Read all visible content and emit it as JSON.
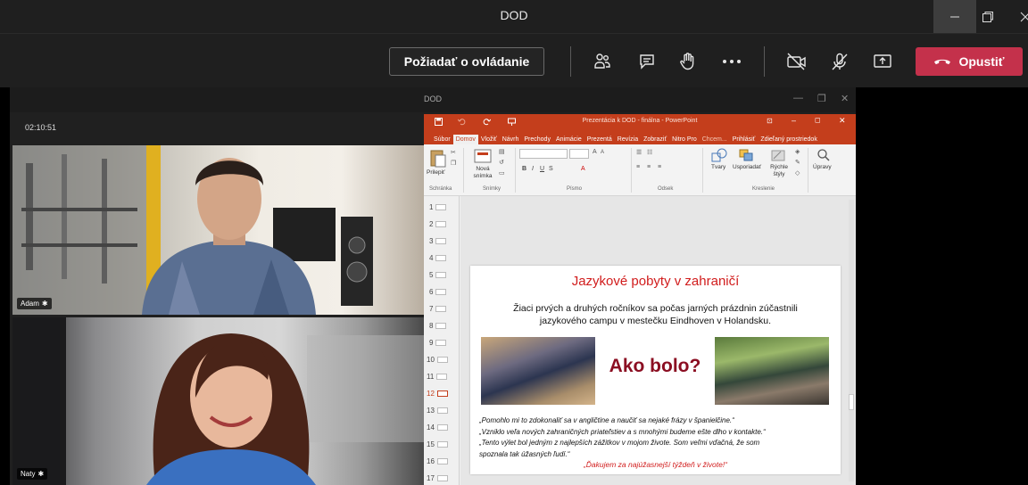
{
  "window": {
    "title": "DOD"
  },
  "toolbar": {
    "request_control_label": "Požiadať o ovládanie",
    "leave_label": "Opustiť",
    "colors": {
      "leave": "#c4314b"
    }
  },
  "share": {
    "window_title": "DOD",
    "elapsed": "02:10:51"
  },
  "participants": [
    {
      "name": "Adam"
    },
    {
      "name": "Naty"
    }
  ],
  "ppt": {
    "title": "Prezentácia k DOD - finálna - PowerPoint",
    "tabs": [
      "Súbor",
      "Domov",
      "Vložiť",
      "Návrh",
      "Prechody",
      "Animácie",
      "Prezentá",
      "Revízia",
      "Zobraziť",
      "Nitro Pro",
      "Chcem...",
      "Prihlásiť",
      "Zdieľaný prostriedok"
    ],
    "active_tab": "Domov",
    "ribbon": {
      "paste": "Prilepiť",
      "new_slide": "Nová snímka",
      "shapes": "Tvary",
      "arrange": "Usporiadať",
      "quick_styles": "Rýchle štýly",
      "edit": "Úpravy",
      "groups": [
        "Schránka",
        "Snímky",
        "Písmo",
        "Odsek",
        "Kreslenie"
      ]
    },
    "thumbnails": [
      "1",
      "2",
      "3",
      "4",
      "5",
      "6",
      "7",
      "8",
      "9",
      "10",
      "11",
      "12",
      "13",
      "14",
      "15",
      "16",
      "17"
    ],
    "selected_thumbnail": "12",
    "slide": {
      "title": "Jazykové pobyty v zahraničí",
      "intro_line1": "Žiaci prvých a druhých ročníkov sa počas jarných prázdnin zúčastnili",
      "intro_line2": "jazykového campu v mestečku Eindhoven v Holandsku.",
      "headline": "Ako bolo?",
      "quote1": "„Pomohlo mi to zdokonaliť sa v angličtine a naučiť sa nejaké frázy v španielčine.“",
      "quote2": "„Vzniklo veľa nových zahraničných priateľstiev a s mnohými budeme ešte dlho v kontakte.“",
      "quote3": "„Tento výlet bol jedným z najlepších zážitkov v mojom živote. Som veľmi vďačná, že som",
      "quote3b": "spoznala tak úžasných ľudí.“",
      "thanks": "„Ďakujem za najúžasnejší týždeň v živote!“",
      "colors": {
        "title": "#d11c1c",
        "headline": "#8b0e22"
      }
    }
  }
}
